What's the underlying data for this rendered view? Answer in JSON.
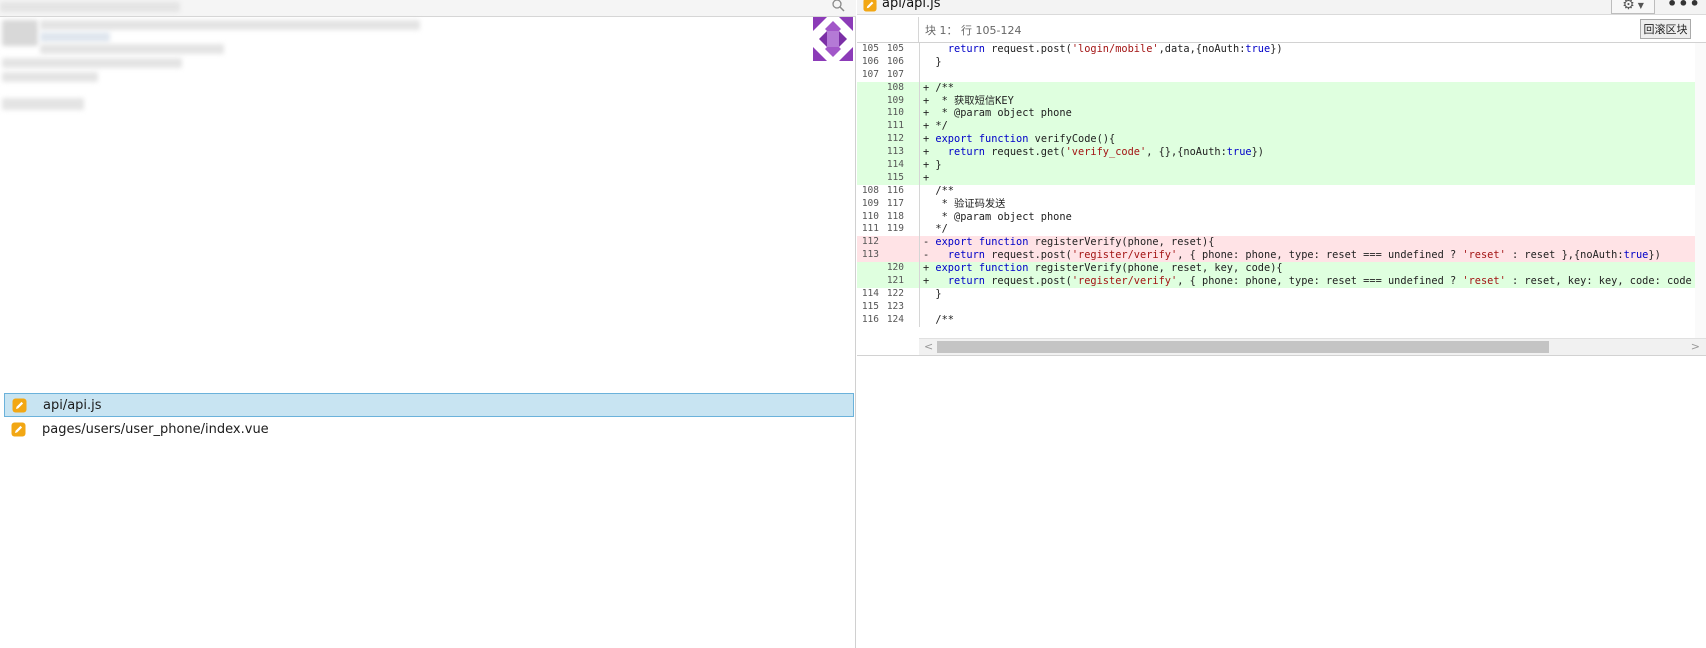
{
  "left_panel": {
    "files": [
      {
        "name": "api/api.js",
        "selected": true,
        "icon": "edit-file-icon"
      },
      {
        "name": "pages/users/user_phone/index.vue",
        "selected": false,
        "icon": "edit-file-icon"
      }
    ]
  },
  "editor": {
    "tab_title": "api/api.js",
    "hunk_info": "块 1： 行 105-124",
    "rollback_label": "回滚区块",
    "icons": {
      "settings": "gear-icon",
      "more": "more-icon"
    },
    "colors": {
      "added_bg": "#dfffdf",
      "removed_bg": "#ffe3e6",
      "selected_bg": "#c8e4f2"
    },
    "diff_lines": [
      {
        "type": "context",
        "old": "105",
        "new": "105",
        "text": "    return request.post('login/mobile',data,{noAuth:true})"
      },
      {
        "type": "context",
        "old": "106",
        "new": "106",
        "text": "  }"
      },
      {
        "type": "context",
        "old": "107",
        "new": "107",
        "text": "  "
      },
      {
        "type": "add",
        "old": "",
        "new": "108",
        "text": "+ /**"
      },
      {
        "type": "add",
        "old": "",
        "new": "109",
        "text": "+  * 获取短信KEY"
      },
      {
        "type": "add",
        "old": "",
        "new": "110",
        "text": "+  * @param object phone"
      },
      {
        "type": "add",
        "old": "",
        "new": "111",
        "text": "+ */"
      },
      {
        "type": "add",
        "old": "",
        "new": "112",
        "text": "+ export function verifyCode(){"
      },
      {
        "type": "add",
        "old": "",
        "new": "113",
        "text": "+   return request.get('verify_code', {},{noAuth:true})"
      },
      {
        "type": "add",
        "old": "",
        "new": "114",
        "text": "+ }"
      },
      {
        "type": "add",
        "old": "",
        "new": "115",
        "text": "+ "
      },
      {
        "type": "context",
        "old": "108",
        "new": "116",
        "text": "  /**"
      },
      {
        "type": "context",
        "old": "109",
        "new": "117",
        "text": "   * 验证码发送"
      },
      {
        "type": "context",
        "old": "110",
        "new": "118",
        "text": "   * @param object phone"
      },
      {
        "type": "context",
        "old": "111",
        "new": "119",
        "text": "  */"
      },
      {
        "type": "del",
        "old": "112",
        "new": "",
        "text": "- export function registerVerify(phone, reset){"
      },
      {
        "type": "del",
        "old": "113",
        "new": "",
        "text": "-   return request.post('register/verify', { phone: phone, type: reset === undefined ? 'reset' : reset },{noAuth:true})"
      },
      {
        "type": "add",
        "old": "",
        "new": "120",
        "text": "+ export function registerVerify(phone, reset, key, code){"
      },
      {
        "type": "add",
        "old": "",
        "new": "121",
        "text": "+   return request.post('register/verify', { phone: phone, type: reset === undefined ? 'reset' : reset, key: key, code: code },"
      },
      {
        "type": "context",
        "old": "114",
        "new": "122",
        "text": "  }"
      },
      {
        "type": "context",
        "old": "115",
        "new": "123",
        "text": "  "
      },
      {
        "type": "context",
        "old": "116",
        "new": "124",
        "text": "  /**"
      }
    ]
  }
}
